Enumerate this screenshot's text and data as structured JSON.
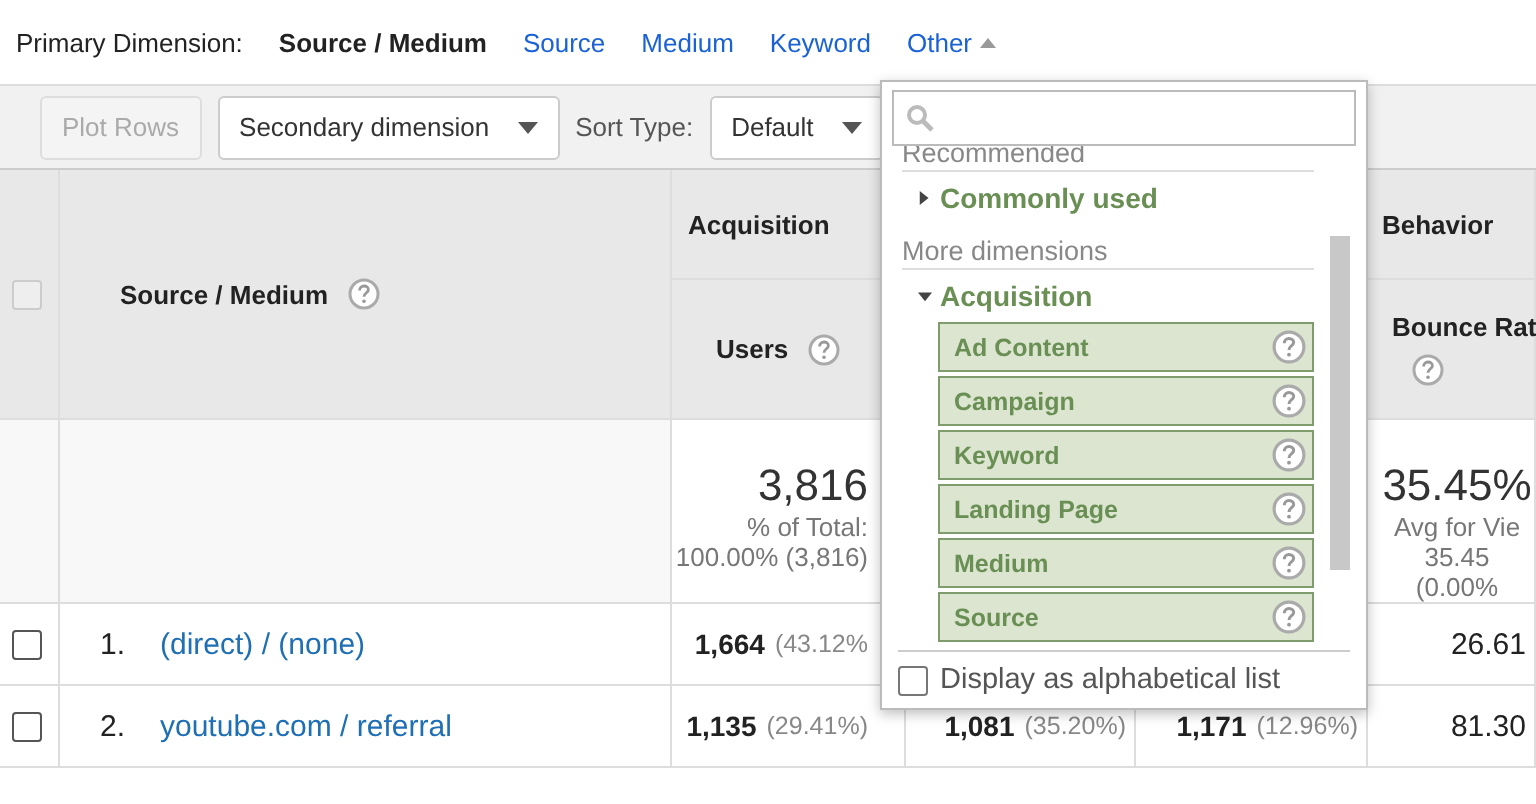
{
  "primary_dimension": {
    "label": "Primary Dimension:",
    "options": [
      {
        "label": "Source / Medium",
        "selected": true
      },
      {
        "label": "Source",
        "selected": false
      },
      {
        "label": "Medium",
        "selected": false
      },
      {
        "label": "Keyword",
        "selected": false
      },
      {
        "label": "Other",
        "selected": false
      }
    ]
  },
  "toolbar": {
    "plot_rows": "Plot Rows",
    "secondary_dimension": "Secondary dimension",
    "sort_label": "Sort Type:",
    "sort_value": "Default"
  },
  "table": {
    "dimension_header": "Source / Medium",
    "groups": [
      "Acquisition",
      "Behavior"
    ],
    "select_all": {
      "disabled": true
    },
    "metrics": [
      "Users",
      "Bounce Rat"
    ],
    "totals": {
      "users": {
        "value": "3,816",
        "lines": [
          "% of Total:",
          "100.00% (3,816)"
        ]
      },
      "bounce_rate": {
        "value": "35.45%",
        "lines": [
          "Avg for Vie",
          "35.45",
          "(0.00%"
        ]
      }
    },
    "rows": [
      {
        "selected": false,
        "index": "1.",
        "name": "(direct) / (none)",
        "users": {
          "value": "1,664",
          "share": "(43.12%"
        },
        "bounce_rate": "26.61"
      },
      {
        "selected": false,
        "index": "2.",
        "name": "youtube.com / referral",
        "users": {
          "value": "1,135",
          "share": "(29.41%)"
        },
        "column_4": {
          "value": "1,081",
          "share": "(35.20%)"
        },
        "column_5": {
          "value": "1,171",
          "share": "(12.96%)"
        },
        "bounce_rate": "81.30"
      }
    ]
  },
  "dimension_menu": {
    "sections": [
      {
        "title": "Recommended",
        "groups": [
          {
            "label": "Commonly used",
            "expanded": false
          }
        ]
      },
      {
        "title": "More dimensions",
        "groups": [
          {
            "label": "Acquisition",
            "expanded": true,
            "items": [
              "Ad Content",
              "Campaign",
              "Keyword",
              "Landing Page",
              "Medium",
              "Source"
            ]
          }
        ]
      }
    ],
    "alphabetical": {
      "label": "Display as alphabetical list",
      "checked": false
    }
  }
}
